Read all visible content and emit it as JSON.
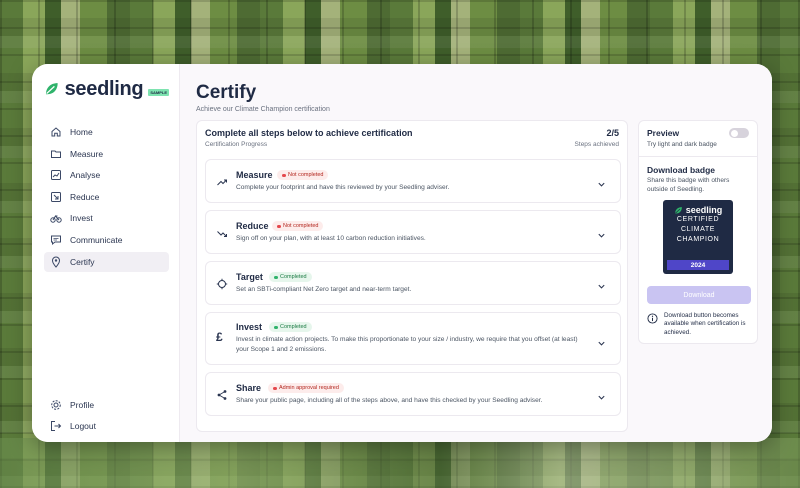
{
  "brand": {
    "name": "seedling",
    "badge": "SAMPLE"
  },
  "sidebar": {
    "items": [
      {
        "label": "Home",
        "icon": "home-icon"
      },
      {
        "label": "Measure",
        "icon": "folder-icon"
      },
      {
        "label": "Analyse",
        "icon": "chart-icon"
      },
      {
        "label": "Reduce",
        "icon": "arrow-down-right-icon"
      },
      {
        "label": "Invest",
        "icon": "bicycle-icon"
      },
      {
        "label": "Communicate",
        "icon": "chat-icon"
      },
      {
        "label": "Certify",
        "icon": "pin-icon",
        "active": true
      }
    ],
    "bottom": [
      {
        "label": "Profile",
        "icon": "gear-icon"
      },
      {
        "label": "Logout",
        "icon": "logout-icon"
      }
    ]
  },
  "page": {
    "title": "Certify",
    "subtitle": "Achieve our Climate Champion certification"
  },
  "steps_card": {
    "title": "Complete all steps below to achieve certification",
    "subtitle": "Certification Progress",
    "count": "2/5",
    "count_label": "Steps achieved"
  },
  "steps": [
    {
      "title": "Measure",
      "status": "Not completed",
      "status_type": "bad",
      "icon": "trend-up-icon",
      "desc": "Complete your footprint and have this reviewed by your Seedling adviser."
    },
    {
      "title": "Reduce",
      "status": "Not completed",
      "status_type": "bad",
      "icon": "trend-down-icon",
      "desc": "Sign off on your plan, with at least 10 carbon reduction initiatives."
    },
    {
      "title": "Target",
      "status": "Completed",
      "status_type": "ok",
      "icon": "crosshair-icon",
      "desc": "Set an SBTi-compliant Net Zero target and near-term target."
    },
    {
      "title": "Invest",
      "status": "Completed",
      "status_type": "ok",
      "icon": "pound-icon",
      "desc": "Invest in climate action projects. To make this proportionate to your size / industry, we require that you offset (at least) your Scope 1 and 2 emissions."
    },
    {
      "title": "Share",
      "status": "Admin approval required",
      "status_type": "bad",
      "icon": "share-icon",
      "desc": "Share your public page, including all of the steps above, and have this checked by your Seedling adviser."
    }
  ],
  "preview": {
    "title": "Preview",
    "subtitle": "Try light and dark badge",
    "toggle_on": false
  },
  "download": {
    "title": "Download badge",
    "subtitle": "Share this badge with others outside of Seedling.",
    "badge_brand": "seedling",
    "badge_line1": "CERTIFIED",
    "badge_line2": "CLIMATE",
    "badge_line3": "CHAMPION",
    "badge_year": "2024",
    "button": "Download",
    "note": "Download button becomes available when certification is achieved."
  },
  "colors": {
    "navy": "#1f2a44",
    "accent": "#4f46c8",
    "disabled_button": "#c9c4f2",
    "brand_green": "#2fb36b"
  }
}
